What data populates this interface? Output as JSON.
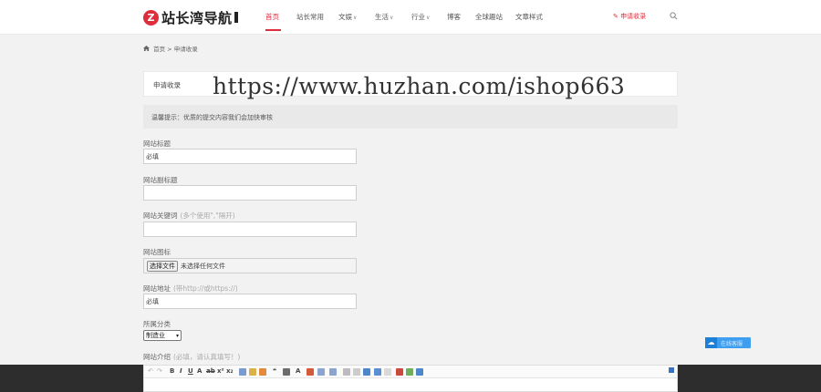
{
  "header": {
    "logo_mark": "Z",
    "logo_text": "站长湾导航",
    "nav": [
      {
        "label": "首页",
        "active": true,
        "dropdown": false
      },
      {
        "label": "站长常用",
        "active": false,
        "dropdown": false
      },
      {
        "label": "文娱",
        "active": false,
        "dropdown": true
      },
      {
        "label": "生活",
        "active": false,
        "dropdown": true
      },
      {
        "label": "行业",
        "active": false,
        "dropdown": true
      },
      {
        "label": "博客",
        "active": false,
        "dropdown": false
      },
      {
        "label": "全球趣站",
        "active": false,
        "dropdown": false
      },
      {
        "label": "文章样式",
        "active": false,
        "dropdown": false
      }
    ],
    "apply_link": "✎ 申请收录",
    "search_icon": "search-icon"
  },
  "breadcrumb": {
    "home": "首页",
    "separator": ">",
    "current": "申请收录"
  },
  "page": {
    "title": "申请收录",
    "watermark": "https://www.huzhan.com/ishop663",
    "notice": "温馨提示：优质的提交内容我们会加快审核"
  },
  "form": {
    "site_name": {
      "label": "网站标题",
      "value": "必填"
    },
    "site_subtitle": {
      "label": "网站副标题",
      "value": ""
    },
    "keywords": {
      "label": "网站关键词",
      "hint": "(多个使用\",\"隔开)",
      "value": ""
    },
    "icon": {
      "label": "网站图标",
      "button": "选择文件",
      "status": "未选择任何文件"
    },
    "url": {
      "label": "网站地址",
      "hint": "(带http://或https://)",
      "value": "必填"
    },
    "category": {
      "label": "所属分类",
      "selected": "制造业"
    },
    "intro": {
      "label": "网站介绍",
      "hint": "(必填，请认真填写！)"
    }
  },
  "float_button": {
    "label": "在线客服",
    "icon": "cloud-icon"
  },
  "colors": {
    "accent": "#e02d3c",
    "float_blue": "#3e9ef0",
    "footer": "#2d2d2d"
  }
}
